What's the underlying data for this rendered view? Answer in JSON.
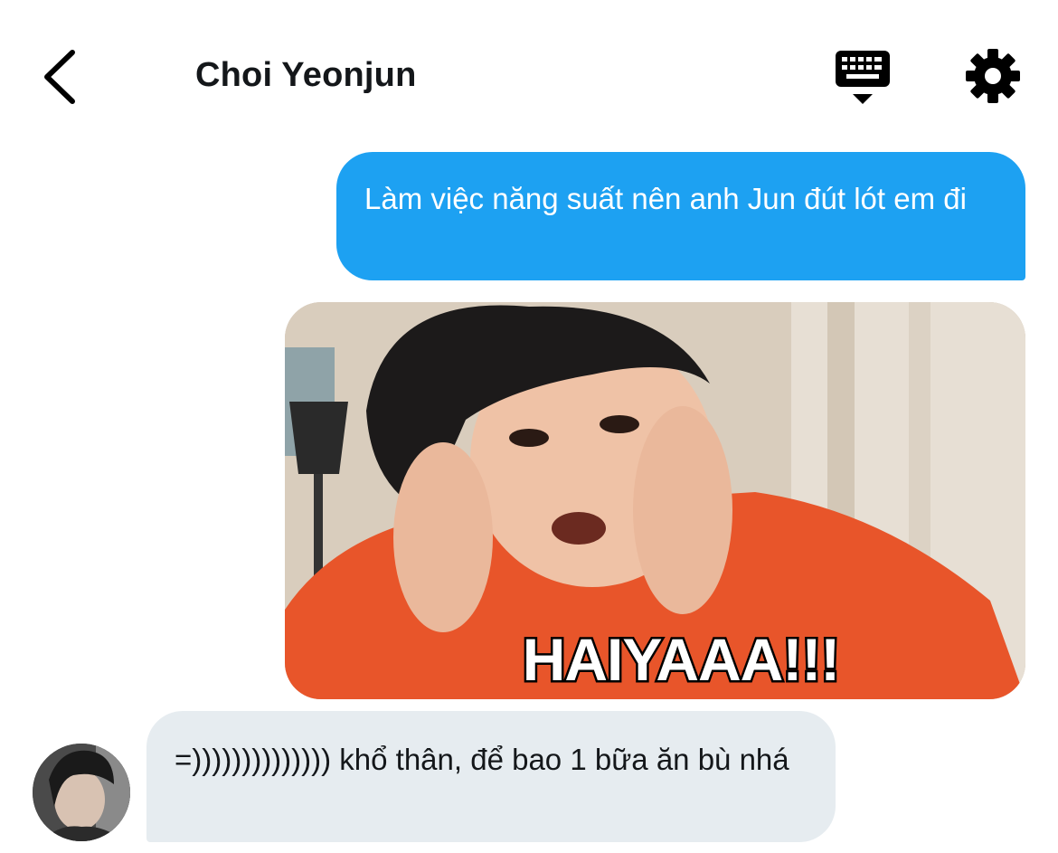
{
  "header": {
    "title": "Choi Yeonjun",
    "back_icon": "chevron-left-icon",
    "keyboard_icon": "keyboard-icon",
    "settings_icon": "gear-icon"
  },
  "messages": [
    {
      "direction": "outgoing",
      "type": "text",
      "text": "Làm việc năng suất nên anh Jun đút lót em đi"
    },
    {
      "direction": "outgoing",
      "type": "media",
      "caption": "HAIYAAA!!!"
    },
    {
      "direction": "incoming",
      "type": "text",
      "text": "=)))))))))))))) khổ thân, để bao 1 bữa ăn bù nhá"
    }
  ],
  "colors": {
    "outgoing_bubble": "#1da1f2",
    "incoming_bubble": "#e6ecf0",
    "text_dark": "#14171a"
  }
}
